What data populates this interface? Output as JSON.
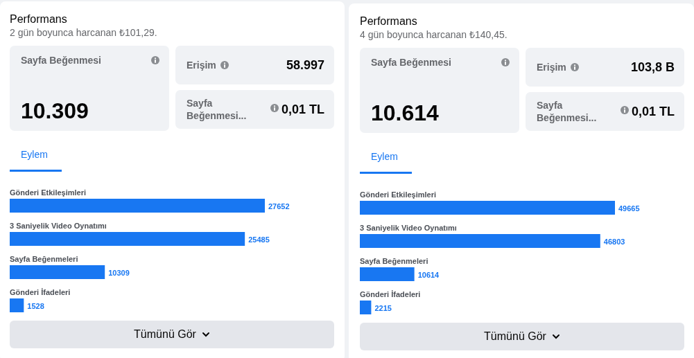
{
  "panels": [
    {
      "title": "Performans",
      "subtitle": "2 gün boyunca harcanan ₺101,29.",
      "main_metric": {
        "label": "Sayfa Beğenmesi",
        "value": "10.309"
      },
      "side_metrics": [
        {
          "label": "Erişim",
          "value": "58.997"
        },
        {
          "label": "Sayfa Beğenmesi...",
          "value": "0,01 TL"
        }
      ],
      "tabs": [
        {
          "label": "Eylem",
          "selected": true
        }
      ],
      "chart_data": {
        "type": "bar",
        "orientation": "horizontal",
        "categories": [
          "Gönderi Etkileşimleri",
          "3 Saniyelik Video Oynatımı",
          "Sayfa Beğenmeleri",
          "Gönderi İfadeleri"
        ],
        "values": [
          27652,
          25485,
          10309,
          1528
        ],
        "data_labels": true
      },
      "button": "Tümünü Gör"
    },
    {
      "title": "Performans",
      "subtitle": "4 gün boyunca harcanan ₺140,45.",
      "main_metric": {
        "label": "Sayfa Beğenmesi",
        "value": "10.614"
      },
      "side_metrics": [
        {
          "label": "Erişim",
          "value": "103,8 B"
        },
        {
          "label": "Sayfa Beğenmesi...",
          "value": "0,01 TL"
        }
      ],
      "tabs": [
        {
          "label": "Eylem",
          "selected": true
        }
      ],
      "chart_data": {
        "type": "bar",
        "orientation": "horizontal",
        "categories": [
          "Gönderi Etkileşimleri",
          "3 Saniyelik Video Oynatımı",
          "Sayfa Beğenmeleri",
          "Gönderi İfadeleri"
        ],
        "values": [
          49665,
          46803,
          10614,
          2215
        ],
        "data_labels": true
      },
      "button": "Tümünü Gör"
    }
  ]
}
